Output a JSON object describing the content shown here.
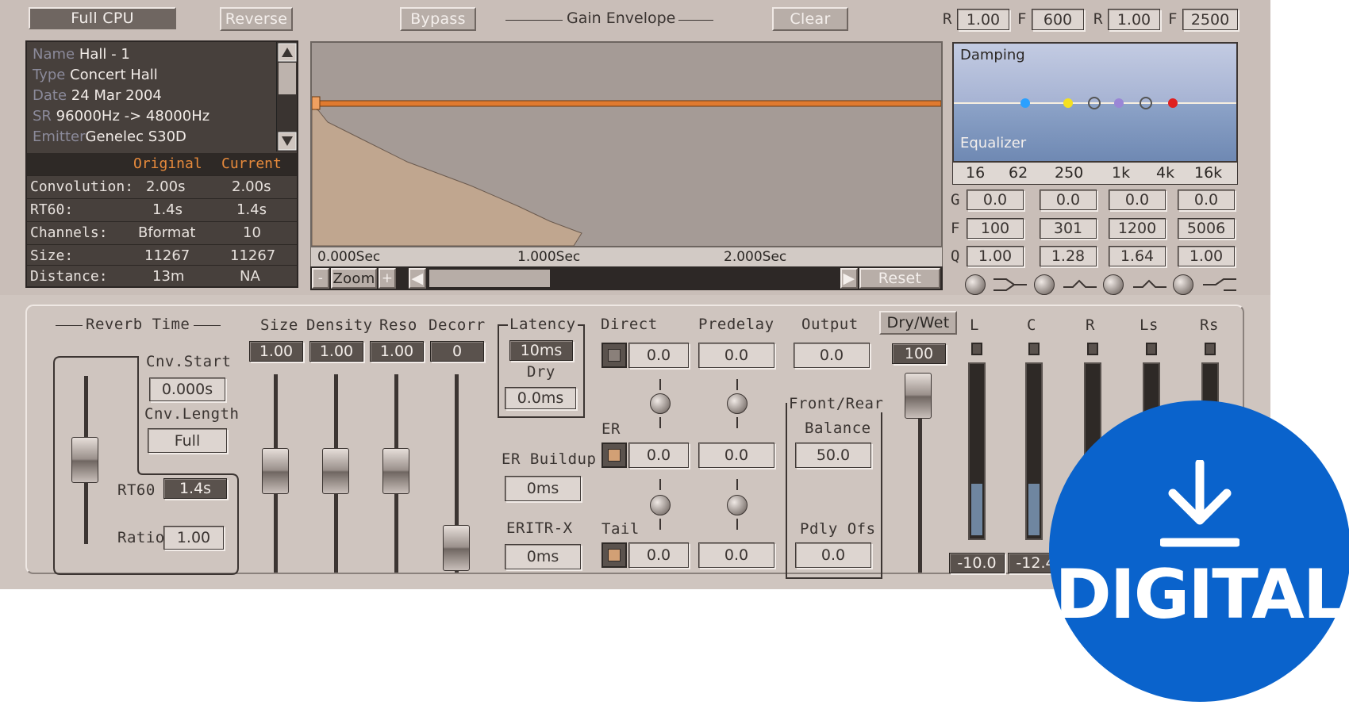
{
  "toolbar": {
    "full_cpu": "Full CPU",
    "reverse": "Reverse",
    "bypass": "Bypass",
    "gain_envelope": "Gain Envelope",
    "clear": "Clear",
    "r1_label": "R",
    "r1_value": "1.00",
    "f1_label": "F",
    "f1_value": "600",
    "r2_label": "R",
    "r2_value": "1.00",
    "f2_label": "F",
    "f2_value": "2500"
  },
  "info": {
    "name_key": "Name",
    "name": "Hall - 1",
    "type_key": "Type",
    "type": "Concert Hall",
    "date_key": "Date",
    "date": "24 Mar 2004",
    "sr_key": "SR",
    "sr": "96000Hz -> 48000Hz",
    "emitter_key": "Emitter",
    "emitter": "Genelec S30D"
  },
  "stats": {
    "col_original": "Original",
    "col_current": "Current",
    "rows": [
      {
        "key": "Convolution:",
        "original": "2.00s",
        "current": "2.00s"
      },
      {
        "key": "RT60:",
        "original": "1.4s",
        "current": "1.4s"
      },
      {
        "key": "Channels:",
        "original": "Bformat",
        "current": "10"
      },
      {
        "key": "Size:",
        "original": "11267",
        "current": "11267"
      },
      {
        "key": "Distance:",
        "original": "13m",
        "current": "NA"
      }
    ]
  },
  "waveform": {
    "t0": "0.000Sec",
    "t1": "1.000Sec",
    "t2": "2.000Sec",
    "zoom": "Zoom",
    "minus": "-",
    "plus": "+",
    "reset": "Reset"
  },
  "eq": {
    "damping": "Damping",
    "equalizer": "Equalizer",
    "scale": [
      "16",
      "62",
      "250",
      "1k",
      "4k",
      "16k"
    ],
    "g_label": "G",
    "f_label": "F",
    "q_label": "Q",
    "g": [
      "0.0",
      "0.0",
      "0.0",
      "0.0"
    ],
    "f": [
      "100",
      "301",
      "1200",
      "5006"
    ],
    "q": [
      "1.00",
      "1.28",
      "1.64",
      "1.00"
    ]
  },
  "reverb": {
    "reverb_time": "Reverb Time",
    "cnv_start": "Cnv.Start",
    "cnv_start_val": "0.000s",
    "cnv_length": "Cnv.Length",
    "cnv_length_val": "Full",
    "rt60": "RT60",
    "rt60_val": "1.4s",
    "ratio": "Ratio",
    "ratio_val": "1.00"
  },
  "params": {
    "size": "Size",
    "size_val": "1.00",
    "density": "Density",
    "density_val": "1.00",
    "reso": "Reso",
    "reso_val": "1.00",
    "decorr": "Decorr",
    "decorr_val": "0"
  },
  "latency": {
    "label": "Latency",
    "value": "10ms",
    "dry": "Dry",
    "dry_val": "0.0ms",
    "er_buildup": "ER Buildup",
    "er_buildup_val": "0ms",
    "eritr": "ERITR-X",
    "eritr_val": "0ms"
  },
  "mix": {
    "direct": "Direct",
    "predelay": "Predelay",
    "output": "Output",
    "direct_val": "0.0",
    "predelay_val": "0.0",
    "output_val": "0.0",
    "er": "ER",
    "er_val": "0.0",
    "er_pre_val": "0.0",
    "tail": "Tail",
    "tail_val": "0.0",
    "tail_pre_val": "0.0",
    "front_rear": "Front/Rear",
    "balance": "Balance",
    "balance_val": "50.0",
    "pdly_ofs": "Pdly Ofs",
    "pdly_ofs_val": "0.0",
    "dry_wet": "Dry/Wet",
    "dry_wet_val": "100"
  },
  "meters": {
    "labels": [
      "L",
      "C",
      "R",
      "Ls",
      "Rs"
    ],
    "levels": [
      0.3,
      0.3,
      0.0,
      0.0,
      0.0
    ],
    "values": [
      "-10.0",
      "-12.4"
    ]
  },
  "badge": {
    "label": "DIGITAL",
    "color": "#0a63cc"
  }
}
